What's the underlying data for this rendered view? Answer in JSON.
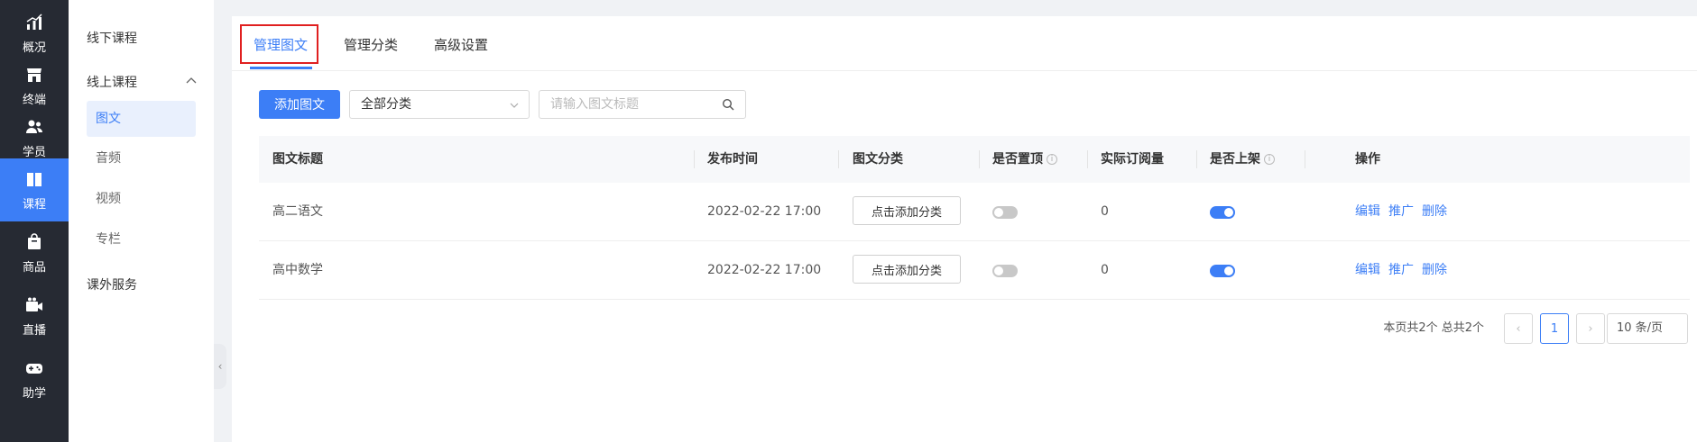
{
  "rail": {
    "items": [
      {
        "label": "概况",
        "icon": "stats-icon"
      },
      {
        "label": "终端",
        "icon": "store-icon"
      },
      {
        "label": "学员",
        "icon": "users-icon"
      },
      {
        "label": "课程",
        "icon": "book-icon"
      },
      {
        "label": "商品",
        "icon": "bag-icon"
      },
      {
        "label": "直播",
        "icon": "video-icon"
      },
      {
        "label": "助学",
        "icon": "gamepad-icon"
      }
    ],
    "active_color": "#3c7ef6"
  },
  "subnav": {
    "offline": "线下课程",
    "online": "线上课程",
    "online_items": [
      "图文",
      "音频",
      "视频",
      "专栏"
    ],
    "extra": "课外服务"
  },
  "tabs": [
    "管理图文",
    "管理分类",
    "高级设置"
  ],
  "toolbar": {
    "add_label": "添加图文",
    "category_select": "全部分类",
    "search_placeholder": "请输入图文标题"
  },
  "table": {
    "headers": [
      "图文标题",
      "发布时间",
      "图文分类",
      "是否置顶",
      "实际订阅量",
      "是否上架",
      "操作"
    ],
    "rows": [
      {
        "title": "高二语文",
        "time": "2022-02-22 17:00",
        "category_btn": "点击添加分类",
        "pinned": false,
        "subs": "0",
        "listed": true
      },
      {
        "title": "高中数学",
        "time": "2022-02-22 17:00",
        "category_btn": "点击添加分类",
        "pinned": false,
        "subs": "0",
        "listed": true
      }
    ],
    "actions": [
      "编辑",
      "推广",
      "删除"
    ]
  },
  "pager": {
    "summary": "本页共2个 总共2个",
    "current_page": "1",
    "page_size": "10 条/页"
  }
}
